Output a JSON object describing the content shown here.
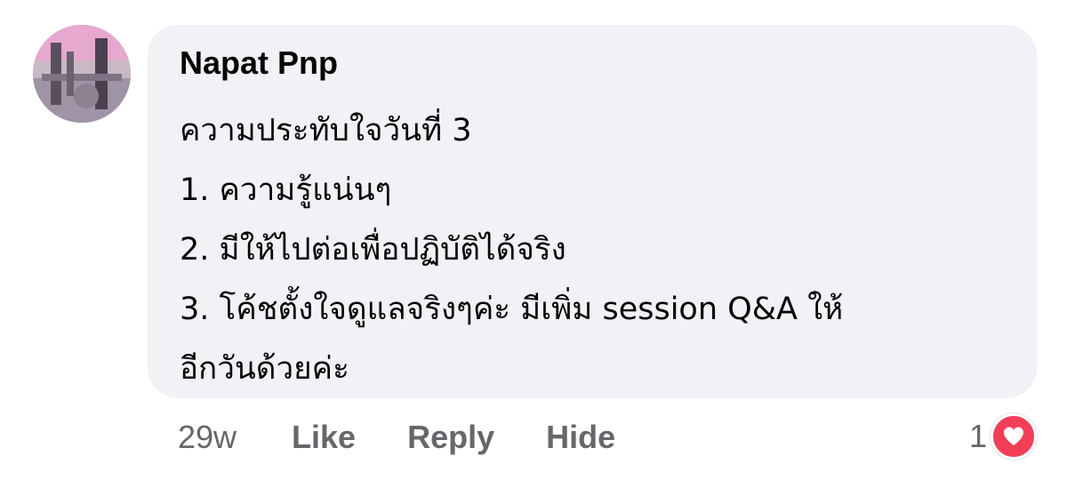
{
  "comment": {
    "author": "Napat Pnp",
    "lines": [
      "ความประทับใจวันที่ 3",
      "1. ความรู้แน่นๆ",
      "2. มีให้ไปต่อเพื่อปฏิบัติได้จริง",
      "3. โค้ชตั้งใจดูแลจริงๆค่ะ มีเพิ่ม session Q&A ให้",
      "อีกวันด้วยค่ะ"
    ]
  },
  "actions": {
    "time": "29w",
    "like": "Like",
    "reply": "Reply",
    "hide": "Hide"
  },
  "reactions": {
    "count": "1",
    "icon": "heart-icon",
    "color": "#f33e58"
  },
  "colors": {
    "bubble": "#f0f2f5",
    "text": "#050505",
    "secondary": "#65676b"
  }
}
